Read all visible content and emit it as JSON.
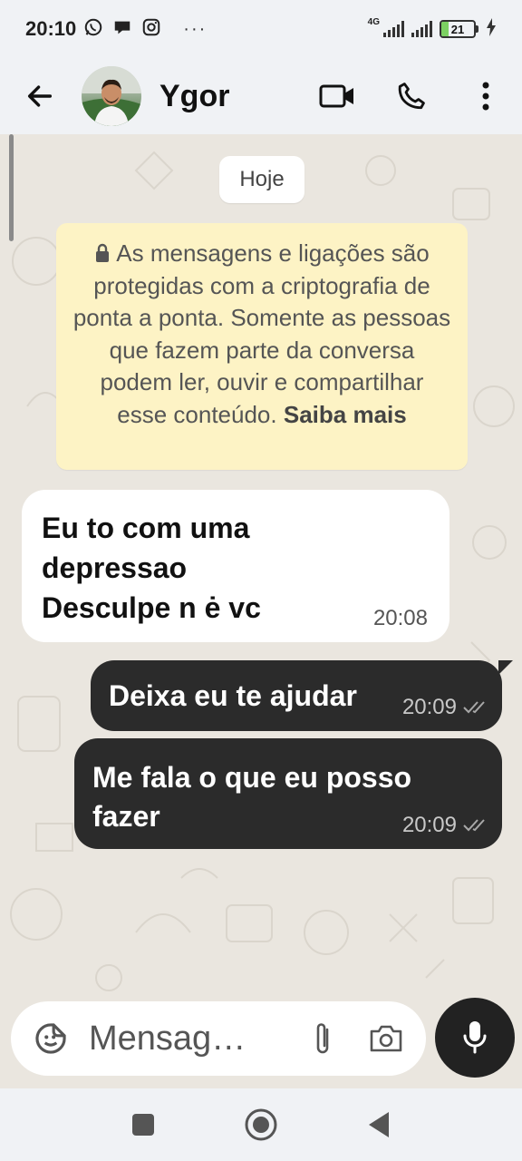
{
  "status_bar": {
    "time": "20:10",
    "network": "4G",
    "battery_level": 21,
    "battery_text": "21",
    "icons": [
      "whatsapp-icon",
      "chat-bubble-icon",
      "instagram-icon",
      "more-dots-icon",
      "signal-icon",
      "battery-icon",
      "charging-icon"
    ]
  },
  "header": {
    "contact_name": "Ygor",
    "icons": [
      "back-arrow-icon",
      "avatar",
      "video-call-icon",
      "voice-call-icon",
      "menu-dots-icon"
    ]
  },
  "chat": {
    "date_label": "Hoje",
    "encryption_notice": {
      "text": "As mensagens e ligações são protegidas com a criptografia de ponta a ponta. Somente as pessoas que fazem parte da conversa podem ler, ouvir e compartilhar esse conteúdo.",
      "learn_more": "Saiba mais"
    },
    "messages": [
      {
        "direction": "incoming",
        "lines": [
          "Eu to com uma",
          "depressao",
          "Desculpe n ė vc"
        ],
        "time": "20:08"
      },
      {
        "direction": "outgoing",
        "text": "Deixa eu te ajudar",
        "time": "20:09",
        "status": "read"
      },
      {
        "direction": "outgoing",
        "lines": [
          "Me fala o que eu posso",
          "fazer"
        ],
        "time": "20:09",
        "status": "read"
      }
    ]
  },
  "composer": {
    "placeholder": "Mensag…",
    "icons": [
      "sticker-icon",
      "attach-icon",
      "camera-icon",
      "mic-icon"
    ]
  },
  "nav_bar": {
    "icons": [
      "recents-icon",
      "home-icon",
      "back-icon"
    ]
  },
  "colors": {
    "outgoing_bubble": "#2b2b2b",
    "incoming_bubble": "#ffffff",
    "notice_bg": "#fdf3c5",
    "chat_bg": "#eae6df",
    "battery_fill": "#7cd162"
  }
}
